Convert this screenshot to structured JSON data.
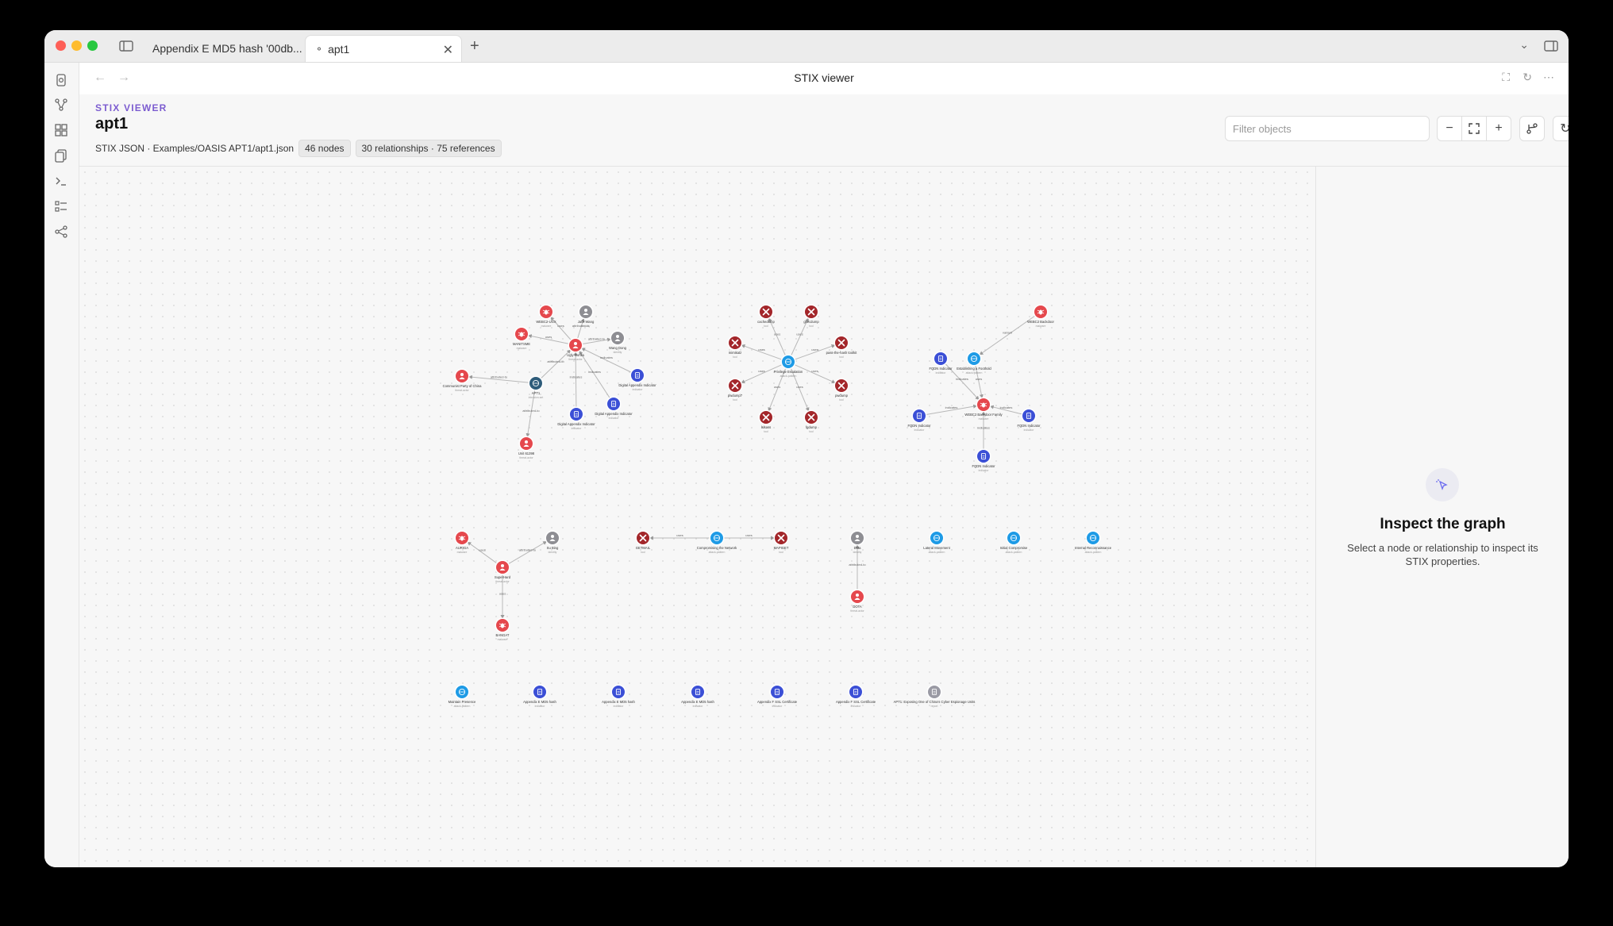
{
  "window": {
    "tabs": [
      {
        "label": "Appendix E MD5 hash '00db..."
      },
      {
        "label": "apt1"
      }
    ]
  },
  "view": {
    "title": "STIX viewer"
  },
  "panel": {
    "kicker": "STIX VIEWER",
    "title": "apt1",
    "source": "STIX JSON · Examples/OASIS APT1/apt1.json",
    "nodes_badge": "46 nodes",
    "relationships_badge": "30 relationships · 75 references"
  },
  "filter": {
    "placeholder": "Filter objects"
  },
  "inspector": {
    "title": "Inspect the graph",
    "description": "Select a node or relationship to inspect its STIX properties."
  },
  "colors": {
    "threat_actor": "#e5484d",
    "malware": "#e5484d",
    "tool": "#a3262a",
    "identity": "#8e8e93",
    "attack_pattern": "#1e9be6",
    "indicator": "#3b4fd6",
    "intrusion_set": "#2e5c7a",
    "report": "#9a9aa4",
    "accent": "#7c5cd0"
  },
  "graph": {
    "nodes": [
      {
        "id": "ugly-gorilla",
        "label": "Ugly Gorilla",
        "sub": "threat-actor",
        "type": "threat_actor"
      },
      {
        "id": "webc2-ugx",
        "label": "WEBC2-UGX",
        "sub": "malware",
        "type": "malware"
      },
      {
        "id": "jack-wang",
        "label": "Jack Wang",
        "sub": "identity",
        "type": "identity"
      },
      {
        "id": "manitsme",
        "label": "MANITSME",
        "sub": "malware",
        "type": "malware"
      },
      {
        "id": "wang-dong",
        "label": "Wang Dong",
        "sub": "identity",
        "type": "identity"
      },
      {
        "id": "ccp",
        "label": "Communist Party of China",
        "sub": "threat-actor",
        "type": "threat_actor"
      },
      {
        "id": "apt1",
        "label": "APT1",
        "sub": "intrusion-set",
        "type": "intrusion_set"
      },
      {
        "id": "ind-a",
        "label": "Digital Appendix Indicator",
        "sub": "indicator",
        "type": "indicator"
      },
      {
        "id": "ind-b",
        "label": "Digital Appendix Indicator",
        "sub": "indicator",
        "type": "indicator"
      },
      {
        "id": "ind-c",
        "label": "Digital Appendix Indicator",
        "sub": "indicator",
        "type": "indicator"
      },
      {
        "id": "unit-61398",
        "label": "Unit 61398",
        "sub": "threat-actor",
        "type": "threat_actor"
      },
      {
        "id": "cachedump",
        "label": "cachedump",
        "sub": "tool",
        "type": "tool"
      },
      {
        "id": "gsecdump",
        "label": "gsecdump",
        "sub": "tool",
        "type": "tool"
      },
      {
        "id": "pass-the-hash",
        "label": "pass-the-hash toolkit",
        "sub": "tool",
        "type": "tool"
      },
      {
        "id": "mimikatz",
        "label": "mimikatz",
        "sub": "tool",
        "type": "tool"
      },
      {
        "id": "privesc",
        "label": "Privilege Escalation",
        "sub": "attack-pattern",
        "type": "attack_pattern"
      },
      {
        "id": "pwdump7",
        "label": "pwdump7",
        "sub": "tool",
        "type": "tool"
      },
      {
        "id": "pwdump",
        "label": "pwdump",
        "sub": "tool",
        "type": "tool"
      },
      {
        "id": "lslsass",
        "label": "lslsass",
        "sub": "tool",
        "type": "tool"
      },
      {
        "id": "fgdump",
        "label": "fgdump",
        "sub": "tool",
        "type": "tool"
      },
      {
        "id": "webc2-s",
        "label": "WEBC2 Backdoor",
        "sub": "malware",
        "type": "malware"
      },
      {
        "id": "fqdn-1",
        "label": "FQDN Indicator",
        "sub": "indicator",
        "type": "indicator"
      },
      {
        "id": "est-foothold",
        "label": "Establishing a Foothold",
        "sub": "attack-pattern",
        "type": "attack_pattern"
      },
      {
        "id": "webc2-grp",
        "label": "WEBC2 Backdoor Family",
        "sub": "malware",
        "type": "malware"
      },
      {
        "id": "fqdn-2",
        "label": "FQDN Indicator",
        "sub": "indicator",
        "type": "indicator"
      },
      {
        "id": "fqdn-3",
        "label": "FQDN Indicator",
        "sub": "indicator",
        "type": "indicator"
      },
      {
        "id": "fqdn-4",
        "label": "FQDN Indicator",
        "sub": "indicator",
        "type": "indicator"
      },
      {
        "id": "auriga",
        "label": "AURIGA",
        "sub": "malware",
        "type": "malware"
      },
      {
        "id": "su-bing",
        "label": "Su Bing",
        "sub": "identity",
        "type": "identity"
      },
      {
        "id": "superhard",
        "label": "SuperHard",
        "sub": "threat-actor",
        "type": "threat_actor"
      },
      {
        "id": "bangat",
        "label": "BANGAT",
        "sub": "malware",
        "type": "malware"
      },
      {
        "id": "gethashes",
        "label": "GETMAIL",
        "sub": "tool",
        "type": "tool"
      },
      {
        "id": "comp-network",
        "label": "Compromising the Network",
        "sub": "attack-pattern",
        "type": "attack_pattern"
      },
      {
        "id": "mapiget",
        "label": "MAPIGET",
        "sub": "tool",
        "type": "tool"
      },
      {
        "id": "dota-id",
        "label": "Dota",
        "sub": "identity",
        "type": "identity"
      },
      {
        "id": "dota",
        "label": "DOTA",
        "sub": "threat-actor",
        "type": "threat_actor"
      },
      {
        "id": "lateral",
        "label": "Lateral Movement",
        "sub": "attack-pattern",
        "type": "attack_pattern"
      },
      {
        "id": "initial",
        "label": "Initial Compromise",
        "sub": "attack-pattern",
        "type": "attack_pattern"
      },
      {
        "id": "recon",
        "label": "Internal Reconnaissance",
        "sub": "attack-pattern",
        "type": "attack_pattern"
      },
      {
        "id": "maintain",
        "label": "Maintain Presence",
        "sub": "attack-pattern",
        "type": "attack_pattern"
      },
      {
        "id": "app-e1",
        "label": "Appendix E MD5 hash",
        "sub": "indicator",
        "type": "indicator"
      },
      {
        "id": "app-e2",
        "label": "Appendix E MD5 hash",
        "sub": "indicator",
        "type": "indicator"
      },
      {
        "id": "app-e3",
        "label": "Appendix E MD5 hash",
        "sub": "indicator",
        "type": "indicator"
      },
      {
        "id": "app-f1",
        "label": "Appendix F SSL Certificate",
        "sub": "indicator",
        "type": "indicator"
      },
      {
        "id": "app-f2",
        "label": "Appendix F SSL Certificate",
        "sub": "indicator",
        "type": "indicator"
      },
      {
        "id": "report",
        "label": "APT1: Exposing One of China's Cyber Espionage Units",
        "sub": "report",
        "type": "report"
      }
    ],
    "edges": [
      {
        "from": "ugly-gorilla",
        "to": "webc2-ugx",
        "label": "uses"
      },
      {
        "from": "ugly-gorilla",
        "to": "jack-wang",
        "label": "attributed-to"
      },
      {
        "from": "ugly-gorilla",
        "to": "manitsme",
        "label": "uses"
      },
      {
        "from": "ugly-gorilla",
        "to": "wang-dong",
        "label": "attributed-to"
      },
      {
        "from": "ind-a",
        "to": "ugly-gorilla",
        "label": "indicates"
      },
      {
        "from": "ind-b",
        "to": "ugly-gorilla",
        "label": "indicates"
      },
      {
        "from": "ind-c",
        "to": "ugly-gorilla",
        "label": "indicates"
      },
      {
        "from": "apt1",
        "to": "ugly-gorilla",
        "label": "attributed-to"
      },
      {
        "from": "apt1",
        "to": "ccp",
        "label": "attributed-to"
      },
      {
        "from": "apt1",
        "to": "unit-61398",
        "label": "attributed-to"
      },
      {
        "from": "privesc",
        "to": "cachedump",
        "label": "uses"
      },
      {
        "from": "privesc",
        "to": "gsecdump",
        "label": "uses"
      },
      {
        "from": "privesc",
        "to": "pass-the-hash",
        "label": "uses"
      },
      {
        "from": "privesc",
        "to": "mimikatz",
        "label": "uses"
      },
      {
        "from": "privesc",
        "to": "pwdump7",
        "label": "uses"
      },
      {
        "from": "privesc",
        "to": "pwdump",
        "label": "uses"
      },
      {
        "from": "privesc",
        "to": "lslsass",
        "label": "uses"
      },
      {
        "from": "privesc",
        "to": "fgdump",
        "label": "uses"
      },
      {
        "from": "fqdn-1",
        "to": "webc2-grp",
        "label": "indicates"
      },
      {
        "from": "est-foothold",
        "to": "webc2-grp",
        "label": "uses"
      },
      {
        "from": "webc2-s",
        "to": "est-foothold",
        "label": "variant"
      },
      {
        "from": "fqdn-2",
        "to": "webc2-grp",
        "label": "indicates"
      },
      {
        "from": "fqdn-3",
        "to": "webc2-grp",
        "label": "indicates"
      },
      {
        "from": "fqdn-4",
        "to": "webc2-grp",
        "label": "indicates"
      },
      {
        "from": "superhard",
        "to": "auriga",
        "label": "uses"
      },
      {
        "from": "superhard",
        "to": "su-bing",
        "label": "attributed-to"
      },
      {
        "from": "superhard",
        "to": "bangat",
        "label": "uses"
      },
      {
        "from": "comp-network",
        "to": "gethashes",
        "label": "uses"
      },
      {
        "from": "comp-network",
        "to": "mapiget",
        "label": "uses"
      },
      {
        "from": "dota",
        "to": "dota-id",
        "label": "attributed-to"
      }
    ]
  }
}
